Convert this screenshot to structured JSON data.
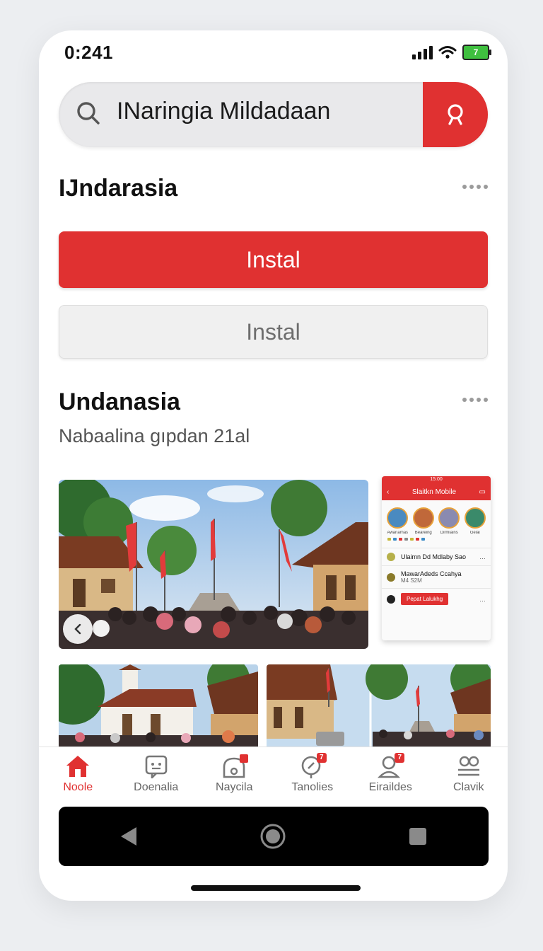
{
  "status_bar": {
    "time": "0:241",
    "battery": "7"
  },
  "search": {
    "query": "INaringia Mildadaan"
  },
  "section1": {
    "title": "IJndarasia"
  },
  "buttons": {
    "primary_label": "Instal",
    "secondary_label": "Instal"
  },
  "section2": {
    "title": "Undanasia",
    "subtitle": "Nabaalina gıpdan 21al"
  },
  "mini_screen": {
    "status": "15:00",
    "title": "Slaitkn Mobile",
    "avatars": [
      "Awanamas",
      "Beareing",
      "Dirmiains",
      "Gelai"
    ],
    "row1": "Ulaimn Dd Mdlaby Sao",
    "row2_title": "MawarAdeds Ccahya",
    "row2_sub": "M4 S2M",
    "row3_button": "Pepat Lalukhg"
  },
  "bottom_nav": {
    "items": [
      {
        "label": "Noole",
        "icon": "home-icon",
        "active": true
      },
      {
        "label": "Doenalia",
        "icon": "chat-icon"
      },
      {
        "label": "Naycila",
        "icon": "lock-icon"
      },
      {
        "label": "Tanolies",
        "icon": "location-icon",
        "badge": "7"
      },
      {
        "label": "Eiraildes",
        "icon": "profile-icon",
        "badge": "7"
      },
      {
        "label": "Clavik",
        "icon": "group-icon"
      }
    ]
  },
  "colors": {
    "accent": "#e03131",
    "text": "#111111",
    "muted": "#6e6e6e"
  }
}
